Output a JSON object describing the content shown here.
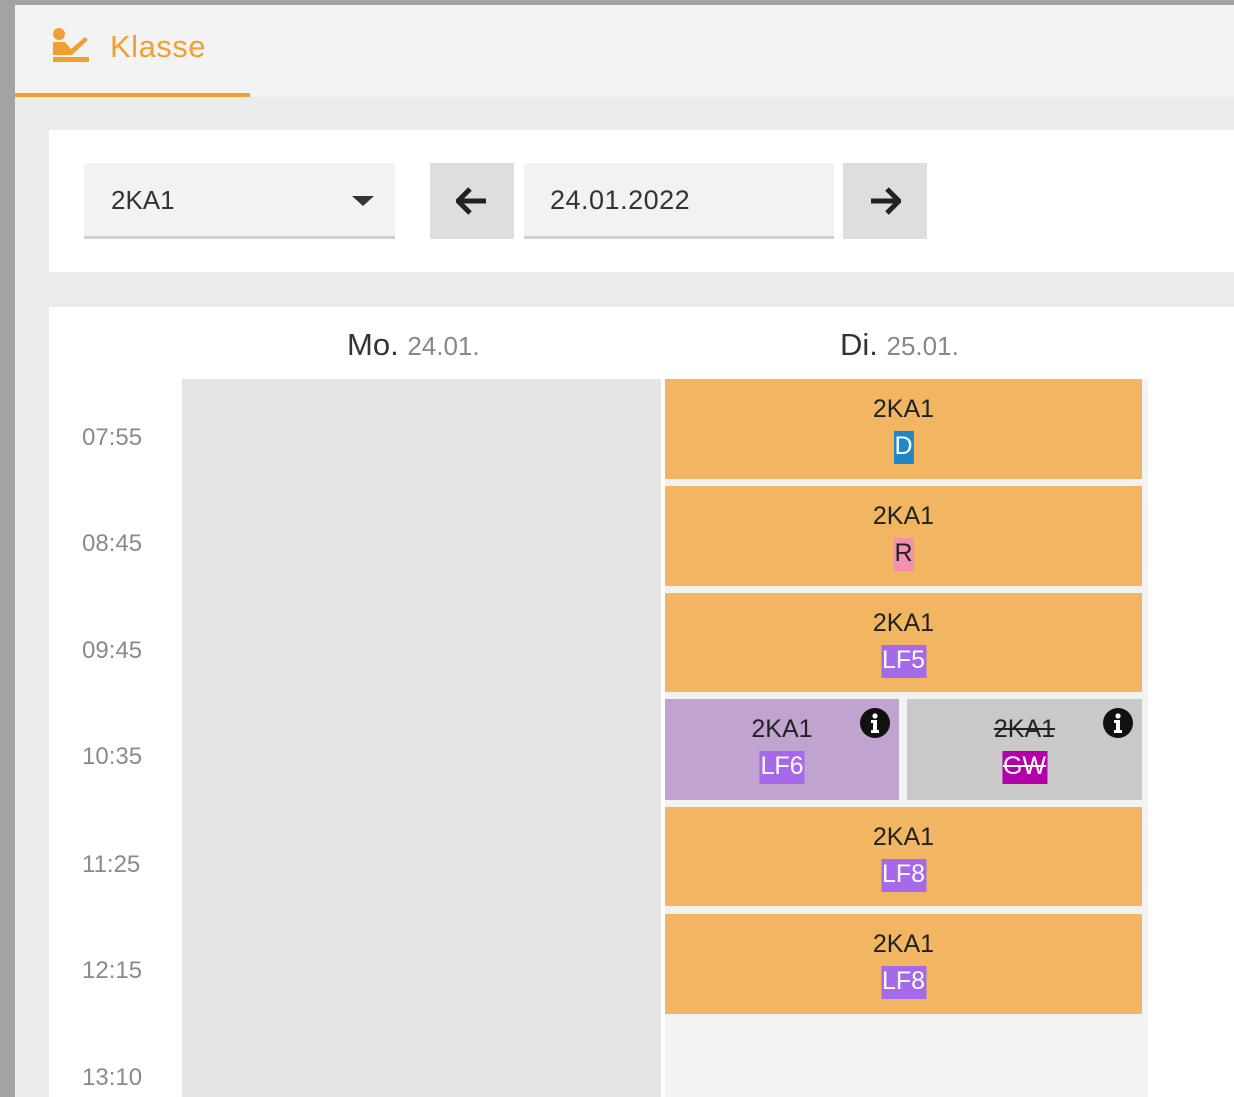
{
  "tab": {
    "label": "Klasse",
    "icon": "teacher-icon"
  },
  "toolbar": {
    "class_select": {
      "value": "2KA1",
      "icon": "caret-down-icon"
    },
    "prev_icon": "arrow-left-icon",
    "next_icon": "arrow-right-icon",
    "date": "24.01.2022"
  },
  "days": [
    {
      "name": "Mo.",
      "date": "24.01."
    },
    {
      "name": "Di.",
      "date": "25.01."
    }
  ],
  "times": [
    "07:55",
    "08:45",
    "09:45",
    "10:35",
    "11:25",
    "12:15",
    "13:10"
  ],
  "lessons": [
    {
      "class": "2KA1",
      "subject": "D",
      "subject_color": "#1f87c7",
      "subject_text_color": "#ffffff",
      "cancelled": false
    },
    {
      "class": "2KA1",
      "subject": "R",
      "subject_color": "#f48fb1",
      "subject_text_color": "#222222",
      "cancelled": false
    },
    {
      "class": "2KA1",
      "subject": "LF5",
      "subject_color": "#a569ea",
      "subject_text_color": "#ffffff",
      "cancelled": false
    },
    {
      "class": "2KA1",
      "subject": "LF6",
      "subject_color": "#a569ea",
      "subject_text_color": "#ffffff",
      "cancelled": false,
      "background": "#c0a3cf",
      "has_info": true
    },
    {
      "class": "2KA1",
      "subject": "GW",
      "subject_color": "#b300a8",
      "subject_text_color": "#ffffff",
      "cancelled": true,
      "background": "#c9c9c9",
      "has_info": true
    },
    {
      "class": "2KA1",
      "subject": "LF8",
      "subject_color": "#a569ea",
      "subject_text_color": "#ffffff",
      "cancelled": false
    },
    {
      "class": "2KA1",
      "subject": "LF8",
      "subject_color": "#a569ea",
      "subject_text_color": "#ffffff",
      "cancelled": false
    }
  ],
  "colors": {
    "accent": "#f0a030",
    "lesson": "#f2b562"
  }
}
